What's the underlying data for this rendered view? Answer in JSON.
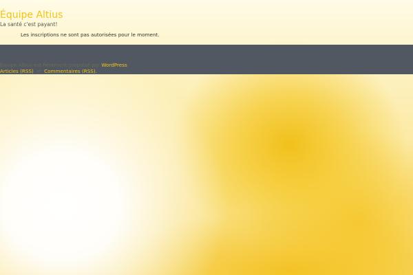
{
  "site": {
    "title": "Équipe Altius",
    "description": "La santé c'est payant!"
  },
  "main": {
    "notice": "Les inscriptions ne sont pas autorisées pour le moment."
  },
  "footer": {
    "credit_prefix": "Équipe Altius est fièrement propulsé par",
    "wordpress_link": "WordPress",
    "articles_rss": "Articles (RSS)",
    "separator": "et",
    "comments_rss": "Commentaires (RSS)."
  },
  "colors": {
    "accent": "#f0c419",
    "footer_bg": "#525861"
  }
}
